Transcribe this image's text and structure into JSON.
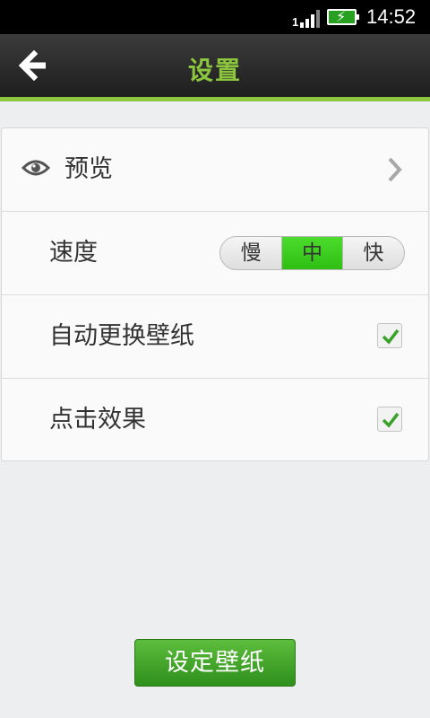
{
  "status_bar": {
    "signal_label": "1",
    "time": "14:52"
  },
  "header": {
    "title": "设置",
    "accent_color": "#8cc63f"
  },
  "settings": {
    "preview": {
      "label": "预览",
      "icon": "eye-icon"
    },
    "speed": {
      "label": "速度",
      "options": [
        "慢",
        "中",
        "快"
      ],
      "selected": "中"
    },
    "auto_change": {
      "label": "自动更换壁纸",
      "checked": true
    },
    "tap_effect": {
      "label": "点击效果",
      "checked": true
    }
  },
  "footer": {
    "set_wallpaper_label": "设定壁纸",
    "button_color": "#3d9e27"
  }
}
